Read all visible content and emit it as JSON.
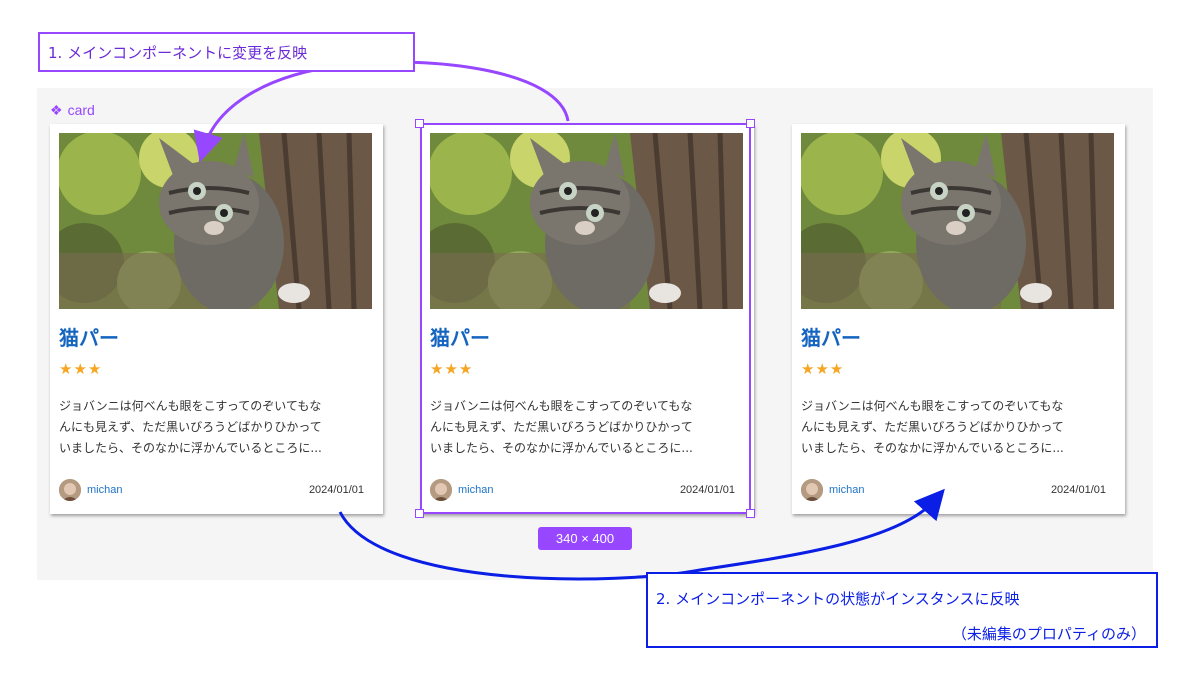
{
  "component_label": {
    "icon": "component-diamond-icon",
    "text": "card"
  },
  "cards": [
    {
      "title": "猫パー",
      "stars": "★★★",
      "desc_lines": [
        "ジョバンニは何べんも眼をこすってのぞいてもな",
        "んにも見えず、ただ黒いびろうどばかりひかって",
        "いましたら、そのなかに浮かんでいるところに..."
      ],
      "author": "michan",
      "date": "2024/01/01"
    },
    {
      "title": "猫パー",
      "stars": "★★★",
      "desc_lines": [
        "ジョバンニは何べんも眼をこすってのぞいてもな",
        "んにも見えず、ただ黒いびろうどばかりひかって",
        "いましたら、そのなかに浮かんでいるところに..."
      ],
      "author": "michan",
      "date": "2024/01/01"
    },
    {
      "title": "猫パー",
      "stars": "★★★",
      "desc_lines": [
        "ジョバンニは何べんも眼をこすってのぞいてもな",
        "んにも見えず、ただ黒いびろうどばかりひかって",
        "いましたら、そのなかに浮かんでいるところに..."
      ],
      "author": "michan",
      "date": "2024/01/01"
    }
  ],
  "size_badge": "340 × 400",
  "annotations": {
    "note1": "1. メインコンポーネントに変更を反映",
    "note2_line1": "2. メインコンポーネントの状態がインスタンスに反映",
    "note2_line2": "（未編集のプロパティのみ）"
  },
  "colors": {
    "selection": "#9747ff",
    "note2": "#0a1ee6",
    "title": "#1565c0",
    "stars": "#f5a623",
    "author": "#1e73c8"
  }
}
